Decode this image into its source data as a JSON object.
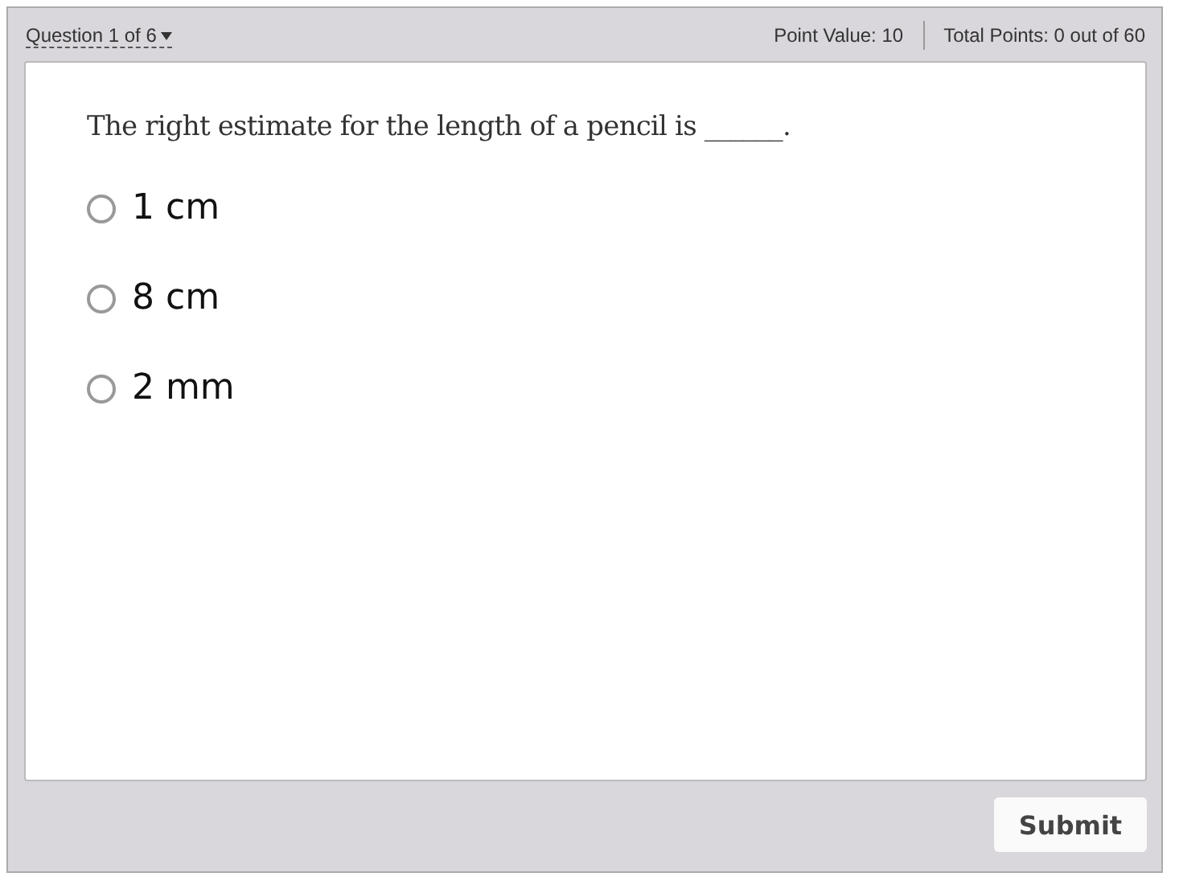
{
  "header": {
    "question_menu": "Question 1 of 6",
    "point_value": "Point Value: 10",
    "total_points": "Total Points: 0 out of 60"
  },
  "question": {
    "prompt": "The right estimate for the length of a pencil is ______.",
    "options": [
      {
        "label": "1 cm",
        "selected": false
      },
      {
        "label": "8 cm",
        "selected": false
      },
      {
        "label": "2 mm",
        "selected": false
      }
    ]
  },
  "buttons": {
    "submit": "Submit"
  }
}
